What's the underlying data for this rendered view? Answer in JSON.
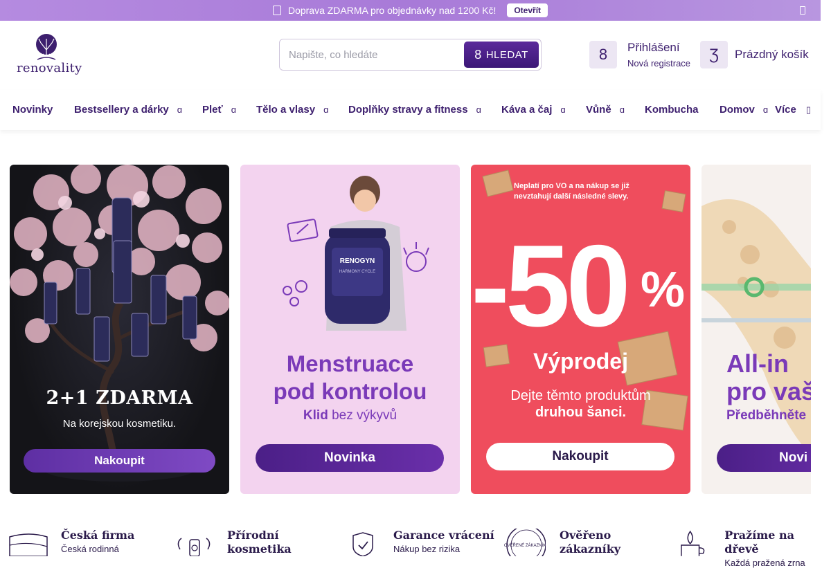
{
  "topbar": {
    "message": "Doprava ZDARMA pro objednávky nad 1200 Kč!",
    "open_label": "Otevřít",
    "info_icon": "info-icon",
    "close_icon": "close-icon"
  },
  "header": {
    "logo_text": "renovality",
    "search": {
      "placeholder": "Napište, co hledáte",
      "value": "",
      "button_label": "HLEDAT",
      "button_glyph": "8"
    },
    "login": {
      "glyph": "8",
      "label": "Přihlášení",
      "register": "Nová registrace"
    },
    "cart": {
      "glyph": "Ʒ",
      "label": "Prázdný košík"
    }
  },
  "nav": {
    "items": [
      {
        "label": "Novinky",
        "has_dropdown": false
      },
      {
        "label": "Bestsellery a dárky",
        "has_dropdown": true
      },
      {
        "label": "Pleť",
        "has_dropdown": true
      },
      {
        "label": "Tělo a vlasy",
        "has_dropdown": true
      },
      {
        "label": "Doplňky stravy a fitness",
        "has_dropdown": true
      },
      {
        "label": "Káva a čaj",
        "has_dropdown": true
      },
      {
        "label": "Vůně",
        "has_dropdown": true
      },
      {
        "label": "Kombucha",
        "has_dropdown": false
      },
      {
        "label": "Domov",
        "has_dropdown": true
      },
      {
        "label": "Více",
        "has_dropdown": true
      }
    ],
    "chevron_glyph": "ɑ"
  },
  "banners": [
    {
      "headline": "2+1 ZDARMA",
      "subtitle": "Na korejskou kosmetiku.",
      "button": "Nakoupit"
    },
    {
      "title_line1": "Menstruace",
      "title_line2": "pod kontrolou",
      "tag_bold": "Klid",
      "tag_rest": " bez výkyvů",
      "button": "Novinka",
      "product_label": "RENOGYN",
      "product_sub": "HARMONY CYCLE"
    },
    {
      "note": "Neplatí pro VO a na nákup se již nevztahují další následné slevy.",
      "big": "-50",
      "percent": "%",
      "title": "Výprodej",
      "desc_line1": "Dejte těmto produktům",
      "desc_line2": "druhou šanci.",
      "button": "Nakoupit"
    },
    {
      "title_line1": "All-in",
      "title_line2": "pro vaš",
      "subtitle": "Předběhněte",
      "button": "Novi"
    }
  ],
  "usps": [
    {
      "title_line1": "Česká firma",
      "title_line2": "",
      "desc": "Česká rodinná"
    },
    {
      "title_line1": "Přírodní",
      "title_line2": "kosmetika",
      "desc": ""
    },
    {
      "title_line1": "Garance vrácení",
      "title_line2": "",
      "desc": "Nákup bez rizika"
    },
    {
      "title_line1": "Ověřeno",
      "title_line2": "zákazníky",
      "desc": "",
      "badge_text": "OVĚŘENÉ ZÁKAZNÍKY"
    },
    {
      "title_line1": "Pražíme na dřevě",
      "title_line2": "",
      "desc": "Každá pražená zrna"
    }
  ],
  "colors": {
    "brand_purple": "#3d1f6e",
    "accent_purple": "#7a3ab8",
    "sale_red": "#ef4d5d",
    "topbar_lilac": "#b58be0"
  }
}
